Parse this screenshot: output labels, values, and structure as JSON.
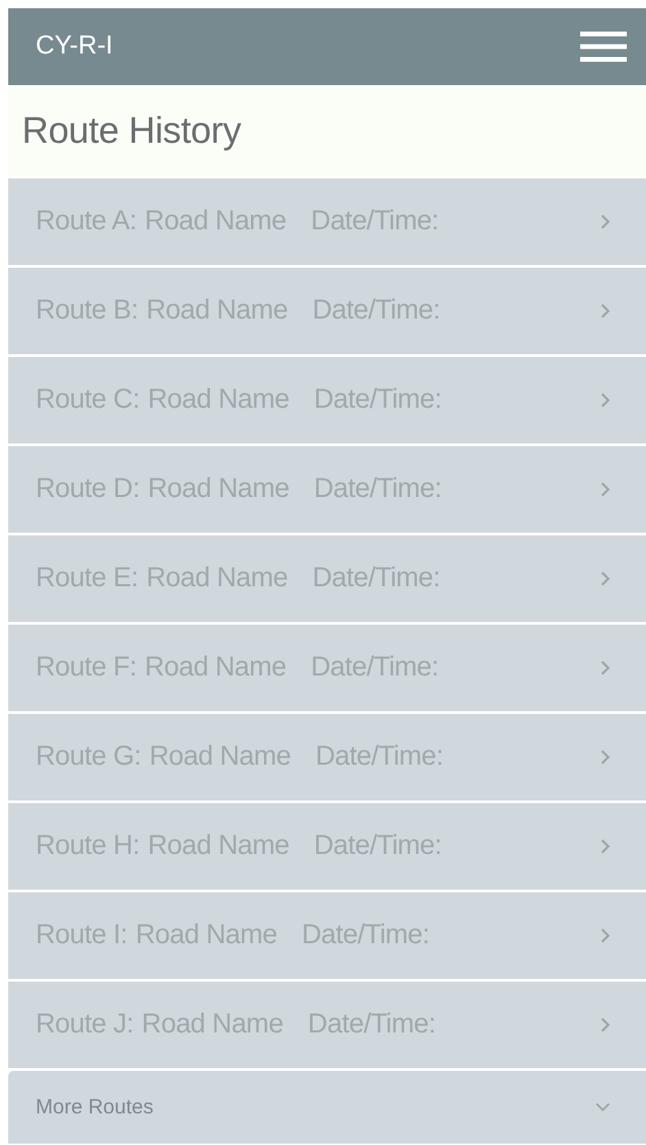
{
  "app_bar": {
    "title": "CY-R-I"
  },
  "page": {
    "title": "Route History"
  },
  "routes": [
    {
      "route": "Route A:",
      "road": "Road Name",
      "date": "Date/Time:"
    },
    {
      "route": "Route B:",
      "road": "Road Name",
      "date": "Date/Time:"
    },
    {
      "route": "Route C:",
      "road": "Road Name",
      "date": "Date/Time:"
    },
    {
      "route": "Route D:",
      "road": "Road Name",
      "date": "Date/Time:"
    },
    {
      "route": "Route E:",
      "road": "Road Name",
      "date": "Date/Time:"
    },
    {
      "route": "Route F:",
      "road": "Road Name",
      "date": "Date/Time:"
    },
    {
      "route": "Route G:",
      "road": "Road Name",
      "date": "Date/Time:"
    },
    {
      "route": "Route H:",
      "road": "Road Name",
      "date": "Date/Time:"
    },
    {
      "route": "Route I:",
      "road": "Road Name",
      "date": "Date/Time:"
    },
    {
      "route": "Route J:",
      "road": "Road Name",
      "date": "Date/Time:"
    }
  ],
  "more": {
    "label": "More Routes"
  }
}
